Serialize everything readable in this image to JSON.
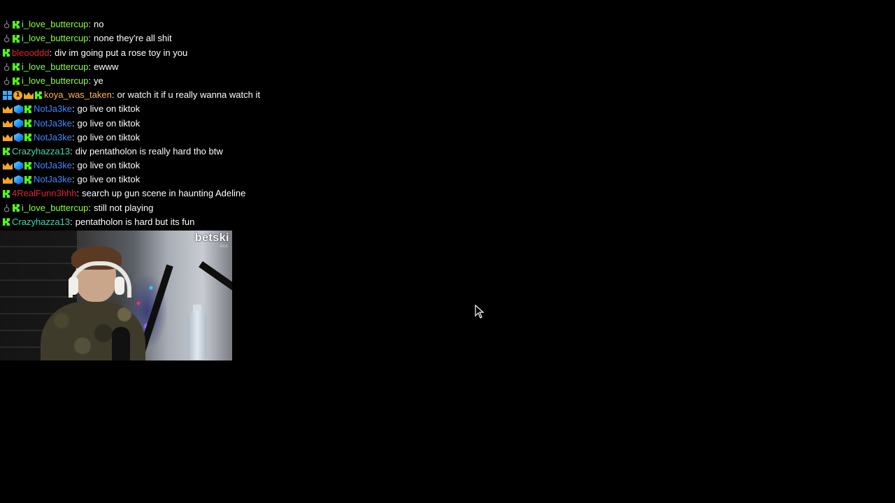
{
  "chat": {
    "messages": [
      {
        "badges": [
          "mod-icon",
          "kick-icon"
        ],
        "user": "i_love_buttercup",
        "color": "#8bff3a",
        "text": "no"
      },
      {
        "badges": [
          "mod-icon",
          "kick-icon"
        ],
        "user": "i_love_buttercup",
        "color": "#8bff3a",
        "text": "none they're all shit"
      },
      {
        "badges": [
          "kick-icon"
        ],
        "user": "bleooddd",
        "color": "#e0213c",
        "text": "div im going put a rose toy in you"
      },
      {
        "badges": [
          "mod-icon",
          "kick-icon"
        ],
        "user": "i_love_buttercup",
        "color": "#8bff3a",
        "text": "ewww"
      },
      {
        "badges": [
          "mod-icon",
          "kick-icon"
        ],
        "user": "i_love_buttercup",
        "color": "#8bff3a",
        "text": "ye"
      },
      {
        "badges": [
          "grid-icon",
          "one-month-icon",
          "crown-icon",
          "kick-icon"
        ],
        "user": "koya_was_taken",
        "color": "#ffb84d",
        "text": "or watch it if u really wanna watch it"
      },
      {
        "badges": [
          "crown-icon",
          "cube-icon",
          "kick-icon"
        ],
        "user": "NotJa3ke",
        "color": "#3d8bff",
        "text": "go live on tiktok"
      },
      {
        "badges": [
          "crown-icon",
          "cube-icon",
          "kick-icon"
        ],
        "user": "NotJa3ke",
        "color": "#3d8bff",
        "text": "go live on tiktok"
      },
      {
        "badges": [
          "crown-icon",
          "cube-icon",
          "kick-icon"
        ],
        "user": "NotJa3ke",
        "color": "#3d8bff",
        "text": "go live on tiktok"
      },
      {
        "badges": [
          "kick-icon"
        ],
        "user": "Crazyhazza13",
        "color": "#3ddcb0",
        "text": "div pentatholon is really hard tho btw"
      },
      {
        "badges": [
          "crown-icon",
          "cube-icon",
          "kick-icon"
        ],
        "user": "NotJa3ke",
        "color": "#3d8bff",
        "text": "go live on tiktok"
      },
      {
        "badges": [
          "crown-icon",
          "cube-icon",
          "kick-icon"
        ],
        "user": "NotJa3ke",
        "color": "#3d8bff",
        "text": "go live on tiktok"
      },
      {
        "badges": [
          "kick-icon"
        ],
        "user": "4RealFunn3hhh",
        "color": "#e0213c",
        "text": "search up gun scene in haunting Adeline"
      },
      {
        "badges": [
          "mod-icon",
          "kick-icon"
        ],
        "user": "i_love_buttercup",
        "color": "#8bff3a",
        "text": "still not playing"
      },
      {
        "badges": [
          "kick-icon"
        ],
        "user": "Crazyhazza13",
        "color": "#3ddcb0",
        "text": "pentatholon is hard but its fun"
      }
    ]
  },
  "webcam": {
    "logo_text": "betski",
    "logo_subtext": "KICK"
  }
}
